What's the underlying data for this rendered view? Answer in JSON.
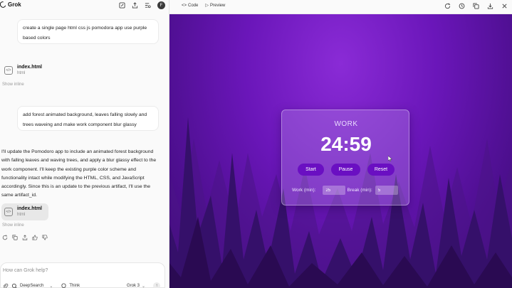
{
  "left": {
    "brand": "Grok",
    "avatar_initial": "F",
    "messages": {
      "user1": "create a single page html css js pomodora app use purple based colors",
      "file1": {
        "name": "index.html",
        "type": "html",
        "show_inline": "Show inline"
      },
      "user2": "add forest animated background, leaves falling slowly and trees waveing and make work component blur glassy",
      "assistant": "I'll update the Pomodoro app to include an animated forest background with falling leaves and waving trees, and apply a blur glassy effect to the work component. I'll keep the existing purple color scheme and functionality intact while modifying the HTML, CSS, and JavaScript accordingly. Since this is an update to the previous artifact, I'll use the same artifact_id.",
      "file2": {
        "name": "index.html",
        "type": "html",
        "show_inline": "Show inline"
      }
    },
    "input": {
      "placeholder": "How can Grok help?",
      "deepsearch": "DeepSearch",
      "think": "Think",
      "model": "Grok 3"
    }
  },
  "right": {
    "tabs": {
      "code": "Code",
      "preview": "Preview"
    },
    "app": {
      "mode": "WORK",
      "timer": "24:59",
      "start": "Start",
      "pause": "Pause",
      "reset": "Reset",
      "work_label": "Work (min):",
      "work_value": "25",
      "break_label": "Break (min):",
      "break_value": "5"
    }
  },
  "colors": {
    "accent": "#6a0fc2",
    "sky_top": "#8a2bd6",
    "sky_bottom": "#3d0b74",
    "trees": "#2a0a52"
  }
}
